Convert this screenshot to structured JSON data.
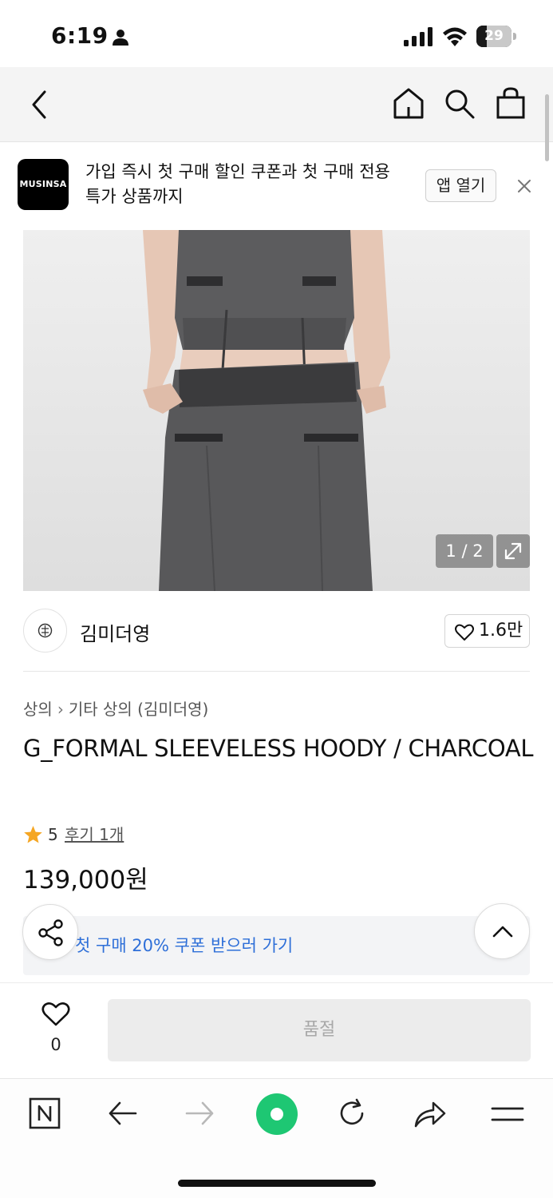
{
  "status_bar": {
    "time": "6:19",
    "battery_level": "29",
    "battery_fraction": 0.29
  },
  "nav": {
    "icons": [
      "back-arrow-icon",
      "home-icon",
      "search-icon",
      "shopping-bag-icon"
    ]
  },
  "app_banner": {
    "logo_text": "MUSINSA",
    "message": "가입 즉시 첫 구매 할인 쿠폰과 첫 구매 전용 특가 상품까지",
    "open_app_label": "앱 열기"
  },
  "gallery": {
    "counter": "1 / 2"
  },
  "brand": {
    "name": "김미더영",
    "like_count": "1.6만"
  },
  "product": {
    "breadcrumb": [
      "상의",
      "기타 상의 (김미더영)"
    ],
    "title": "G_FORMAL SLEEVELESS HOODY / CHARCOAL",
    "rating": "5",
    "review_link": "후기 1개",
    "price": "139,000원",
    "coupon_text": "첫 구매 20% 쿠폰 받으러 가기"
  },
  "purchase_bar": {
    "wish_count": "0",
    "buy_button_label": "품절"
  },
  "browser_toolbar": {
    "items": [
      "naver-icon",
      "back-icon",
      "forward-icon",
      "green-dot-icon",
      "refresh-icon",
      "share-icon",
      "menu-icon"
    ]
  },
  "colors": {
    "accent_blue": "#2e6fd8",
    "star": "#f5a623",
    "naver_green": "#1ec773",
    "soldout_bg": "#ececec"
  }
}
